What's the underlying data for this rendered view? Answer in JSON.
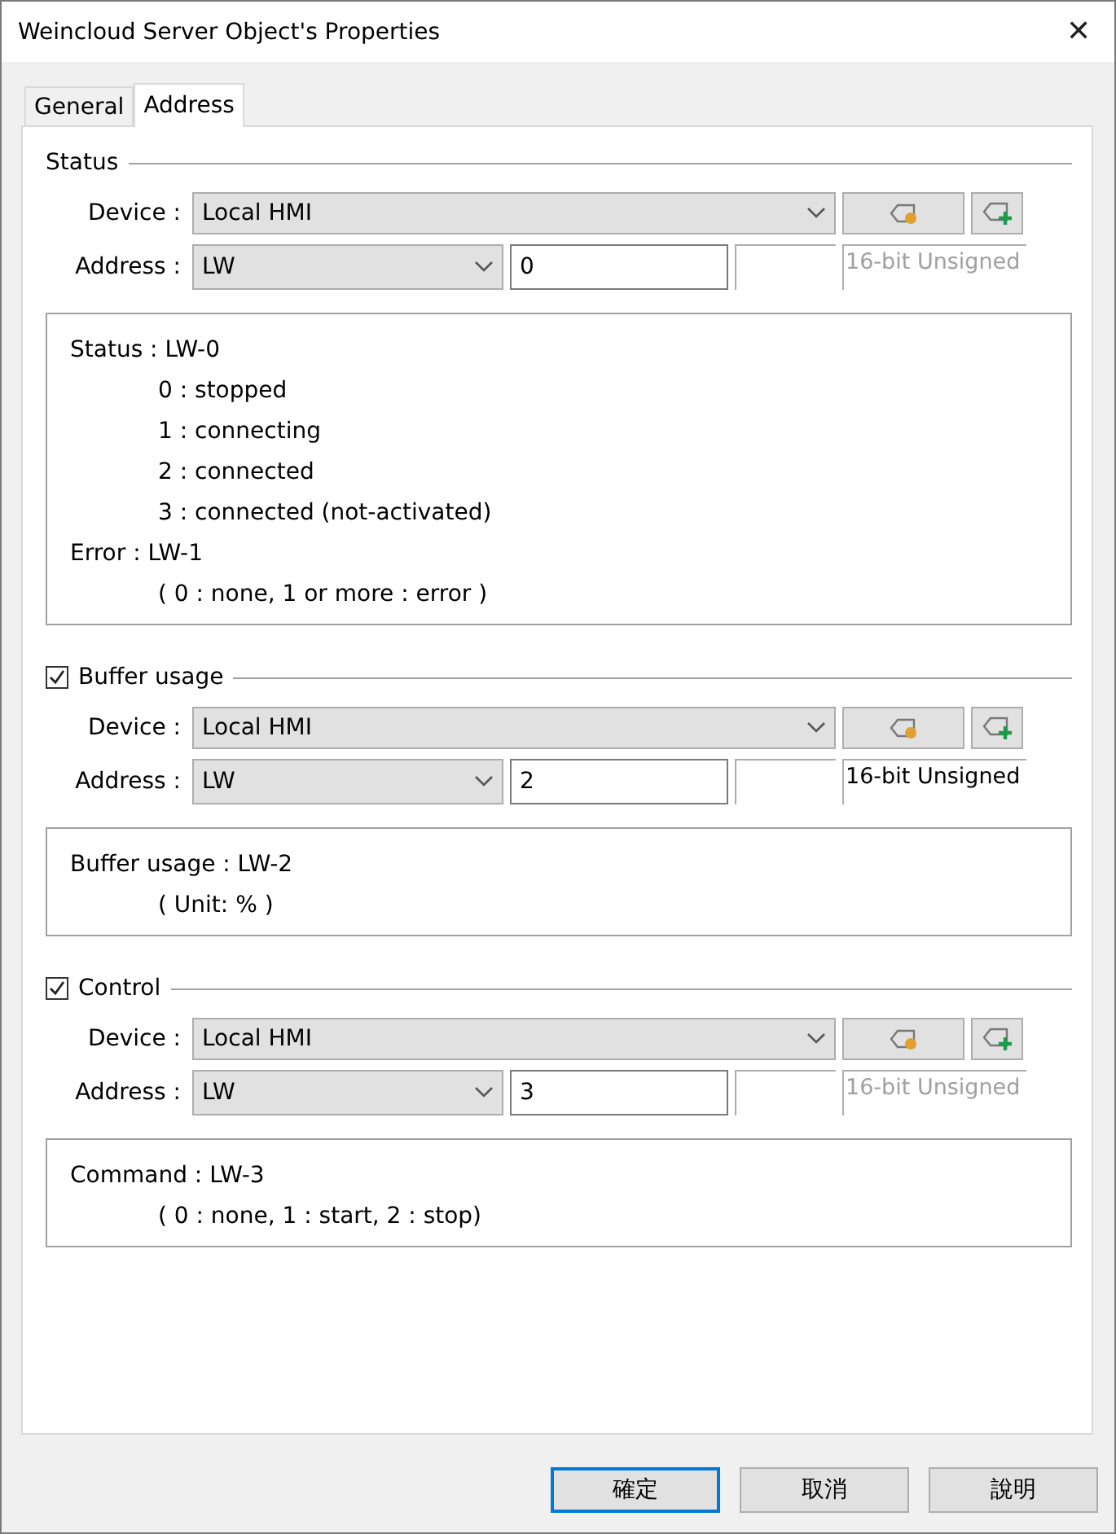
{
  "window": {
    "title": "Weincloud Server Object's Properties",
    "close": "✕"
  },
  "tabs": [
    {
      "label": "General",
      "selected": false
    },
    {
      "label": "Address",
      "selected": true
    }
  ],
  "sections": [
    {
      "kind": "plain",
      "title": "Status",
      "device_label": "Device :",
      "device": "Local HMI",
      "address_label": "Address :",
      "address_type": "LW",
      "address": "0",
      "data_type": "16-bit Unsigned",
      "data_type_disabled": true,
      "info": [
        {
          "text": "Status : LW-0",
          "children": [
            {
              "text": "0 : stopped"
            },
            {
              "text": "1 : connecting"
            },
            {
              "text": "2 : connected"
            },
            {
              "text": "3 : connected (not-activated)"
            }
          ]
        },
        {
          "text": "Error : LW-1",
          "children": [
            {
              "text": "( 0 : none, 1 or more : error )"
            }
          ]
        }
      ]
    },
    {
      "kind": "checkbox",
      "checked": true,
      "title": "Buffer usage",
      "device_label": "Device :",
      "device": "Local HMI",
      "address_label": "Address :",
      "address_type": "LW",
      "address": "2",
      "data_type": "16-bit Unsigned",
      "data_type_disabled": false,
      "info": [
        {
          "text": "Buffer usage : LW-2",
          "children": [
            {
              "text": "( Unit: % )"
            }
          ]
        }
      ]
    },
    {
      "kind": "checkbox",
      "checked": true,
      "title": "Control",
      "device_label": "Device :",
      "device": "Local HMI",
      "address_label": "Address :",
      "address_type": "LW",
      "address": "3",
      "data_type": "16-bit Unsigned",
      "data_type_disabled": true,
      "info": [
        {
          "text": "Command : LW-3",
          "children": [
            {
              "text": "( 0 : none, 1 : start, 2 : stop)"
            }
          ]
        }
      ]
    }
  ],
  "buttons": [
    {
      "label": "確定",
      "selected": true
    },
    {
      "label": "取消",
      "selected": false
    },
    {
      "label": "說明",
      "selected": false
    }
  ]
}
